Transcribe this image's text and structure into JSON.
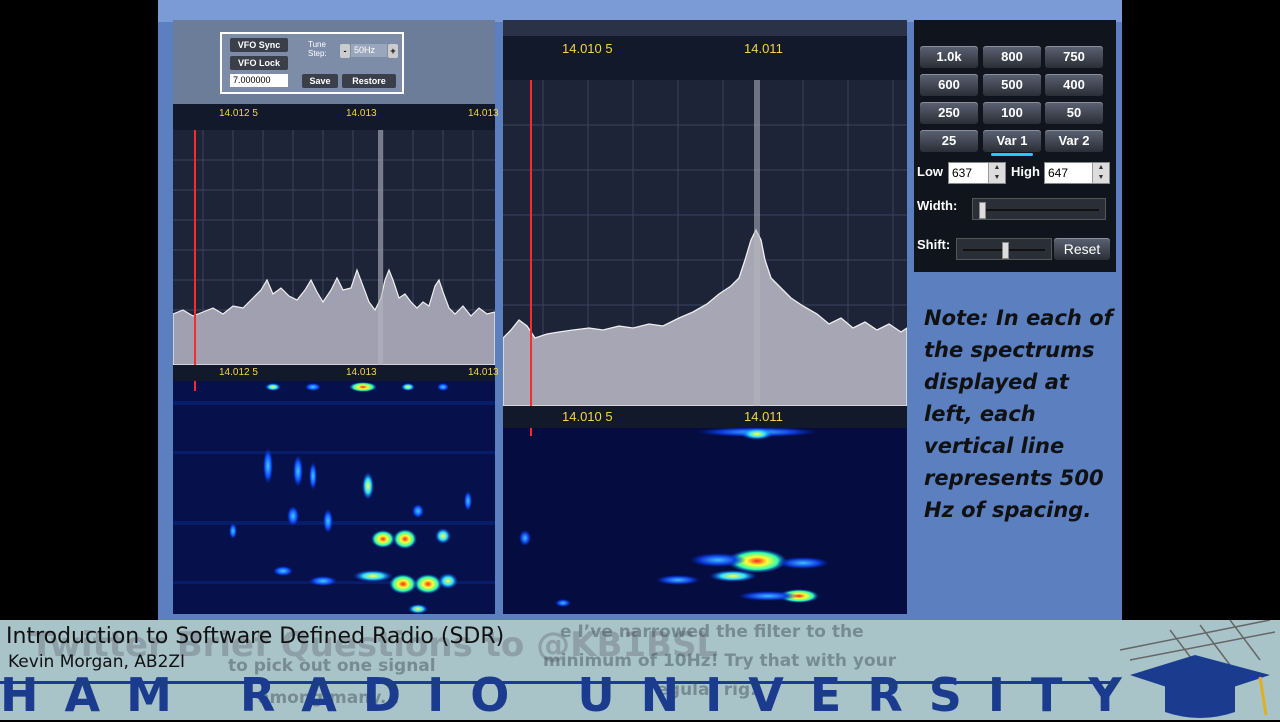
{
  "left_panel": {
    "controls": {
      "vfo_sync": "VFO Sync",
      "vfo_lock": "VFO Lock",
      "vfo_value": "7.000000",
      "tune_step_label_1": "Tune",
      "tune_step_label_2": "Step:",
      "tune_step_minus": "-",
      "tune_step_value": "50Hz",
      "tune_step_plus": "+",
      "save": "Save",
      "restore": "Restore"
    },
    "spectrum_axis": [
      "14.012 5",
      "14.013",
      "14.013"
    ],
    "waterfall_axis": [
      "14.012 5",
      "14.013",
      "14.013"
    ]
  },
  "mid_panel": {
    "spectrum_axis": [
      "14.010 5",
      "14.011"
    ],
    "waterfall_axis": [
      "14.010 5",
      "14.011"
    ]
  },
  "filter_panel": {
    "buttons": [
      "1.0k",
      "800",
      "750",
      "600",
      "500",
      "400",
      "250",
      "100",
      "50",
      "25",
      "Var 1",
      "Var 2"
    ],
    "selected": "Var 1",
    "low_label": "Low",
    "low_value": "637",
    "high_label": "High",
    "high_value": "647",
    "width_label": "Width:",
    "shift_label": "Shift:",
    "reset": "Reset"
  },
  "note": "Note: In each of the spectrums displayed at left, each vertical line represents 500 Hz of spacing.",
  "banner": {
    "title": "Introduction to Software Defined Radio (SDR)",
    "author": "Kevin Morgan, AB2ZI",
    "org": "HAM RADIO UNIVERSITY",
    "ghost_overlay": "Twitter Brief Questions to @KB1BSL",
    "ghost_caption_left_1": "to pick out one signal",
    "ghost_caption_left_2": "among many...",
    "ghost_caption_mid_1": "e I’ve narrowed the filter to the",
    "ghost_caption_mid_2": "minimum of 10Hz! Try that with your",
    "ghost_caption_mid_3": "regular rig."
  },
  "colors": {
    "slide_bg": "#5b7fbf",
    "axis_text": "#f4d54a",
    "marker": "#ff2a2a",
    "banner_bg": "#a8c4c9",
    "org_text": "#1b3b8f"
  }
}
